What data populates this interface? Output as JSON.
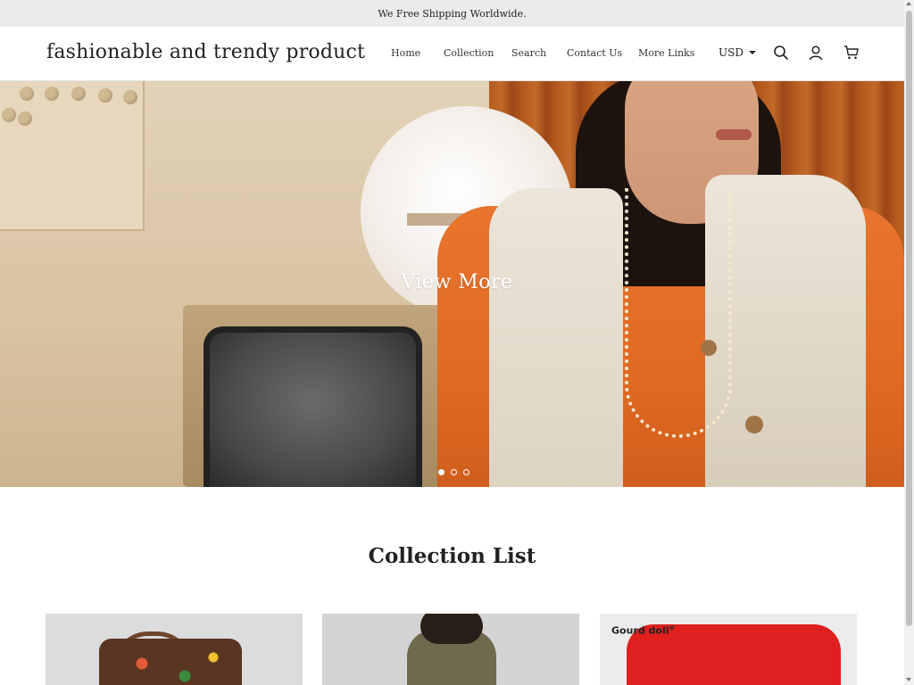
{
  "announcement": {
    "text": "We Free Shipping Worldwide."
  },
  "header": {
    "site_title": "fashionable and trendy product",
    "nav": [
      {
        "label": "Home"
      },
      {
        "label": "Collection"
      },
      {
        "label": "Search"
      },
      {
        "label": "Contact Us"
      },
      {
        "label": "More Links"
      }
    ],
    "currency": "USD",
    "icons": [
      "search-icon",
      "user-icon",
      "cart-icon"
    ]
  },
  "hero": {
    "cta_label": "View More",
    "slides_total": 3,
    "active_slide": 1
  },
  "collection": {
    "title": "Collection List",
    "cards": [
      {
        "label": ""
      },
      {
        "label": ""
      },
      {
        "label": "Gourd doll",
        "mark": "®"
      }
    ]
  },
  "colors": {
    "announcement_bg": "#ebebeb",
    "text": "#222222",
    "accent_orange": "#e06a22"
  }
}
